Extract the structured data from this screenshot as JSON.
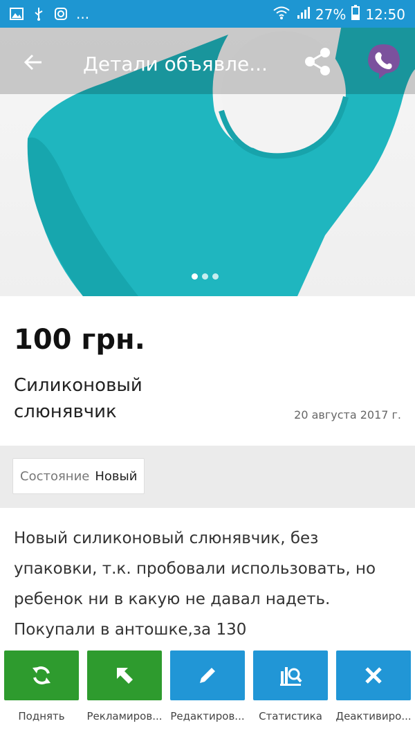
{
  "status_bar": {
    "battery": "27%",
    "time": "12:50",
    "more": "..."
  },
  "toolbar": {
    "title": "Детали объявле..."
  },
  "gallery": {
    "pages": 3,
    "current": 1
  },
  "listing": {
    "price": "100 грн.",
    "title": "Силиконовый слюнявчик",
    "date": "20 августа 2017 г."
  },
  "params": [
    {
      "key": "Состояние",
      "value": "Новый"
    }
  ],
  "description": "Новый силиконовый слюнявчик, без упаковки, т.к. пробовали использовать, но ребенок ни в какую не давал надеть. Покупали в антошке,за 130",
  "actions": [
    {
      "label": "Поднять",
      "icon": "refresh-icon",
      "color": "#2e9b2e"
    },
    {
      "label": "Рекламиров...",
      "icon": "arrow-up-left-icon",
      "color": "#2e9b2e"
    },
    {
      "label": "Редактиров...",
      "icon": "pencil-icon",
      "color": "#2196d6"
    },
    {
      "label": "Статистика",
      "icon": "stats-icon",
      "color": "#2196d6"
    },
    {
      "label": "Деактивиро...",
      "icon": "close-icon",
      "color": "#2196d6"
    }
  ],
  "colors": {
    "status_bar": "#1e96d2",
    "green": "#2e9b2e",
    "blue": "#2196d6",
    "bib": "#1fb6bf"
  }
}
